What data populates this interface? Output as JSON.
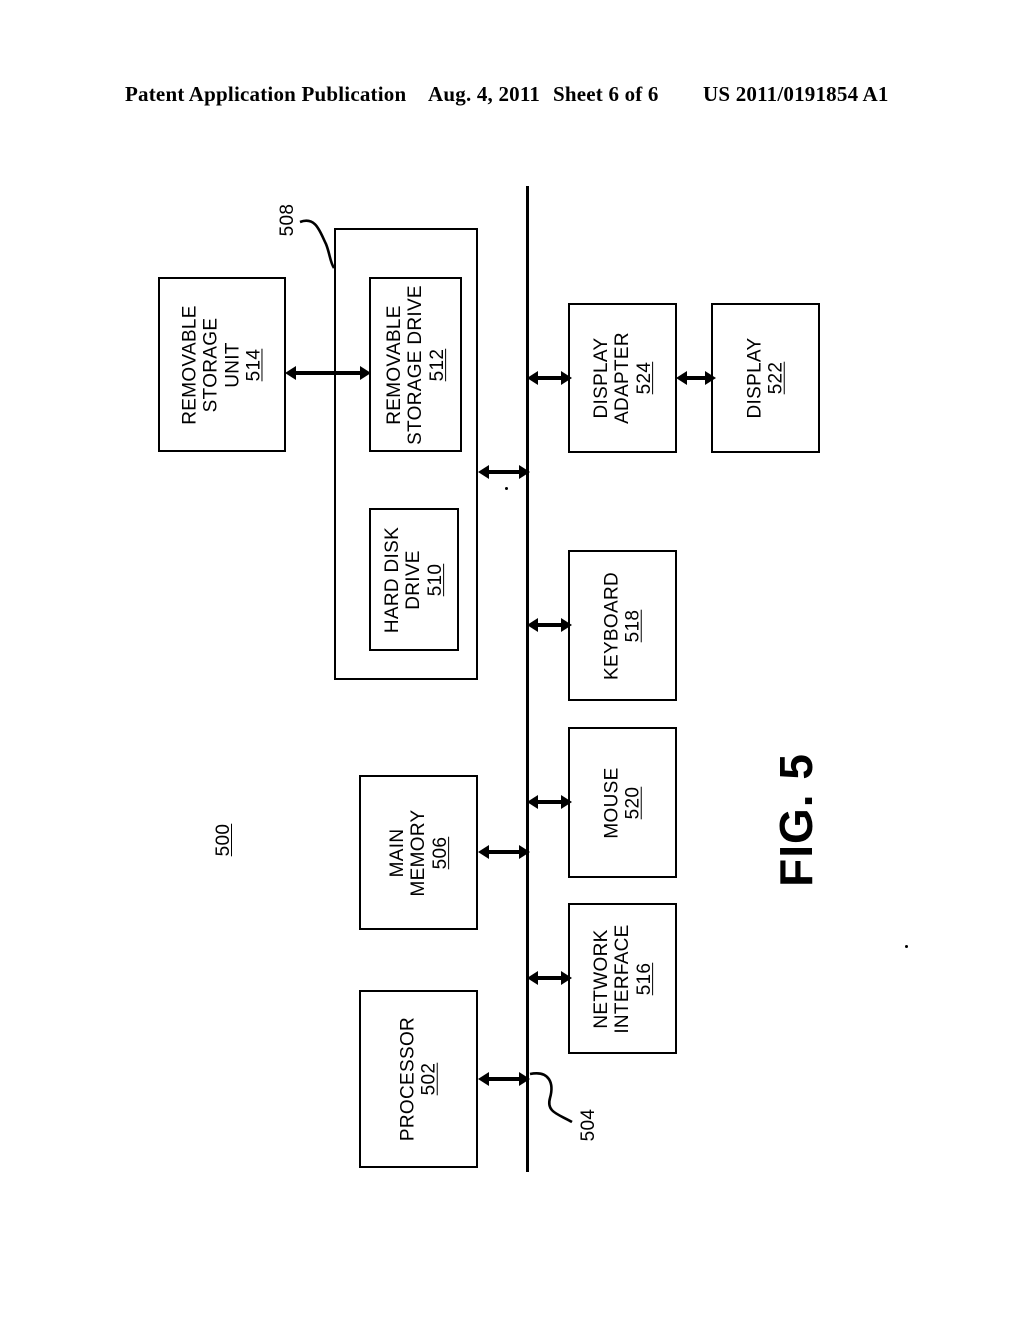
{
  "header": {
    "publication": "Patent Application Publication",
    "date": "Aug. 4, 2011",
    "sheet": "Sheet 6 of 6",
    "patent_number": "US 2011/0191854 A1"
  },
  "figure": {
    "caption": "FIG. 5",
    "system_ref": "500",
    "bus_ref": "504",
    "secondary_memory_ref": "508"
  },
  "blocks": {
    "processor": {
      "line1": "PROCESSOR",
      "num": "502"
    },
    "main_memory": {
      "line1": "MAIN",
      "line2": "MEMORY",
      "num": "506"
    },
    "hard_disk_drive": {
      "line1": "HARD DISK",
      "line2": "DRIVE",
      "num": "510"
    },
    "removable_storage_drive": {
      "line1": "REMOVABLE",
      "line2": "STORAGE DRIVE",
      "num": "512"
    },
    "removable_storage_unit": {
      "line1": "REMOVABLE",
      "line2": "STORAGE",
      "line3": "UNIT",
      "num": "514"
    },
    "network_interface": {
      "line1": "NETWORK",
      "line2": "INTERFACE",
      "num": "516"
    },
    "keyboard": {
      "line1": "KEYBOARD",
      "num": "518"
    },
    "mouse": {
      "line1": "MOUSE",
      "num": "520"
    },
    "display": {
      "line1": "DISPLAY",
      "num": "522"
    },
    "display_adapter": {
      "line1": "DISPLAY",
      "line2": "ADAPTER",
      "num": "524"
    }
  },
  "colors": {
    "ink": "#000000",
    "paper": "#ffffff"
  }
}
